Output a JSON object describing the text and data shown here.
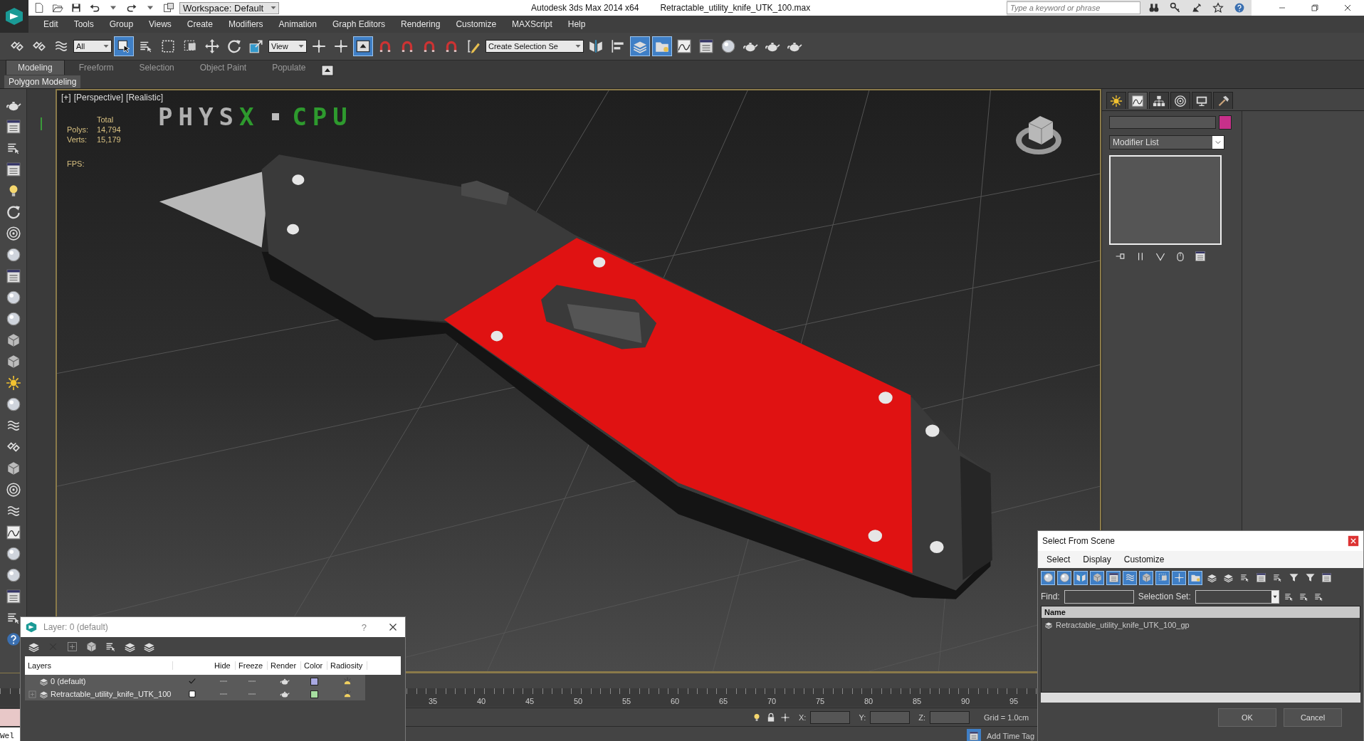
{
  "title_bar": {
    "workspace": "Workspace: Default",
    "app": "Autodesk 3ds Max  2014 x64",
    "file": "Retractable_utility_knife_UTK_100.max",
    "search": {
      "placeholder": "Type a keyword or phrase"
    }
  },
  "menu": [
    "Edit",
    "Tools",
    "Group",
    "Views",
    "Create",
    "Modifiers",
    "Animation",
    "Graph Editors",
    "Rendering",
    "Customize",
    "MAXScript",
    "Help"
  ],
  "toolbar": [
    {
      "kind": "button",
      "selected": false
    },
    {
      "kind": "button",
      "selected": false
    },
    {
      "kind": "button",
      "selected": false
    },
    {
      "kind": "dropdown",
      "value": "All"
    },
    {
      "kind": "button",
      "selected": true
    },
    {
      "kind": "button",
      "selected": false
    },
    {
      "kind": "button",
      "selected": false
    },
    {
      "kind": "button",
      "selected": false
    },
    {
      "kind": "button",
      "selected": false
    },
    {
      "kind": "button",
      "selected": false
    },
    {
      "kind": "button",
      "selected": false
    },
    {
      "kind": "dropdown",
      "value": "View"
    },
    {
      "kind": "button",
      "selected": false
    },
    {
      "kind": "button",
      "selected": false
    },
    {
      "kind": "button",
      "selected": true
    },
    {
      "kind": "button",
      "selected": false
    },
    {
      "kind": "button",
      "selected": false
    },
    {
      "kind": "button",
      "selected": false
    },
    {
      "kind": "button",
      "selected": false
    },
    {
      "kind": "button",
      "selected": false
    },
    {
      "kind": "dropdown",
      "value": "Create Selection Se"
    },
    {
      "kind": "button",
      "selected": false
    },
    {
      "kind": "button",
      "selected": false
    },
    {
      "kind": "button",
      "selected": true
    },
    {
      "kind": "button",
      "selected": true
    },
    {
      "kind": "button",
      "selected": false
    },
    {
      "kind": "button",
      "selected": false
    },
    {
      "kind": "button",
      "selected": false
    },
    {
      "kind": "button",
      "selected": false
    },
    {
      "kind": "button",
      "selected": false
    },
    {
      "kind": "button",
      "selected": false
    }
  ],
  "ribbon": {
    "tabs": [
      {
        "label": "Modeling",
        "selected": true
      },
      {
        "label": "Freeform",
        "selected": false
      },
      {
        "label": "Selection",
        "selected": false
      },
      {
        "label": "Object Paint",
        "selected": false
      },
      {
        "label": "Populate",
        "selected": false
      }
    ],
    "panel": "Polygon Modeling"
  },
  "viewport": {
    "labels": [
      "[+]",
      "[Perspective]",
      "[Realistic]"
    ],
    "stats": {
      "header": "Total",
      "rows": [
        {
          "label": "Polys:",
          "value": "14,794"
        },
        {
          "label": "Verts:",
          "value": "15,179"
        }
      ],
      "fps": "FPS:"
    },
    "physx": {
      "name": [
        "PHYS",
        "X"
      ],
      "mode": "CPU"
    }
  },
  "command_panel": {
    "tabs": [
      {
        "selected": false
      },
      {
        "selected": true
      },
      {
        "selected": false
      },
      {
        "selected": false
      },
      {
        "selected": false
      },
      {
        "selected": false
      }
    ],
    "modifier_list": "Modifier List"
  },
  "timeline": {
    "ticks": [
      "35",
      "40",
      "45",
      "50",
      "55",
      "60",
      "65",
      "70",
      "75",
      "80",
      "85",
      "90",
      "95"
    ]
  },
  "status": {
    "x": "X:",
    "y": "Y:",
    "z": "Z:",
    "grid": "Grid = 1.0cm",
    "time_tag": "Add Time Tag",
    "listener": "Wel"
  },
  "layer_dialog": {
    "title": "Layer: 0 (default)",
    "help": "?",
    "columns": [
      "Layers",
      "Hide",
      "Freeze",
      "Render",
      "Color",
      "Radiosity"
    ],
    "rows": [
      {
        "name": "0 (default)",
        "current": true,
        "expandable": false,
        "color": "#a9a9e2"
      },
      {
        "name": "Retractable_utility_knife_UTK_100",
        "current": false,
        "expandable": true,
        "color": "#a6dea0"
      }
    ]
  },
  "scene_dialog": {
    "title": "Select From Scene",
    "menu": [
      "Select",
      "Display",
      "Customize"
    ],
    "toolbar": [
      {
        "selected": true
      },
      {
        "selected": true
      },
      {
        "selected": true
      },
      {
        "selected": true
      },
      {
        "selected": true
      },
      {
        "selected": true
      },
      {
        "selected": true
      },
      {
        "selected": true
      },
      {
        "selected": true
      },
      {
        "selected": true
      },
      {
        "selected": false
      },
      {
        "selected": false
      },
      {
        "selected": false
      },
      {
        "selected": false
      },
      {
        "selected": false
      },
      {
        "selected": false
      },
      {
        "selected": false
      },
      {
        "selected": false
      }
    ],
    "find": "Find:",
    "selection_set": "Selection Set:",
    "column": "Name",
    "rows": [
      "Retractable_utility_knife_UTK_100_gp"
    ],
    "buttons": [
      "OK",
      "Cancel"
    ]
  }
}
